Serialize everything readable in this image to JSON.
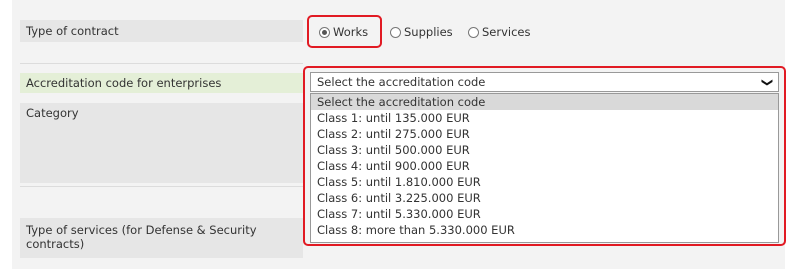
{
  "contract_type": {
    "label": "Type of contract",
    "options": [
      {
        "label": "Works",
        "checked": true
      },
      {
        "label": "Supplies",
        "checked": false
      },
      {
        "label": "Services",
        "checked": false
      }
    ]
  },
  "accreditation": {
    "label": "Accreditation code for enterprises",
    "selected": "Select the accreditation code",
    "options": [
      "Select the accreditation code",
      "Class 1: until 135.000 EUR",
      "Class 2: until 275.000 EUR",
      "Class 3: until 500.000 EUR",
      "Class 4: until 900.000 EUR",
      "Class 5: until 1.810.000 EUR",
      "Class 6: until 3.225.000 EUR",
      "Class 7: until 5.330.000 EUR",
      "Class 8: more than 5.330.000 EUR"
    ],
    "highlight_color": "#e11a23"
  },
  "category": {
    "label": "Category"
  },
  "services_type": {
    "label": "Type of services (for Defense & Security contracts)"
  }
}
